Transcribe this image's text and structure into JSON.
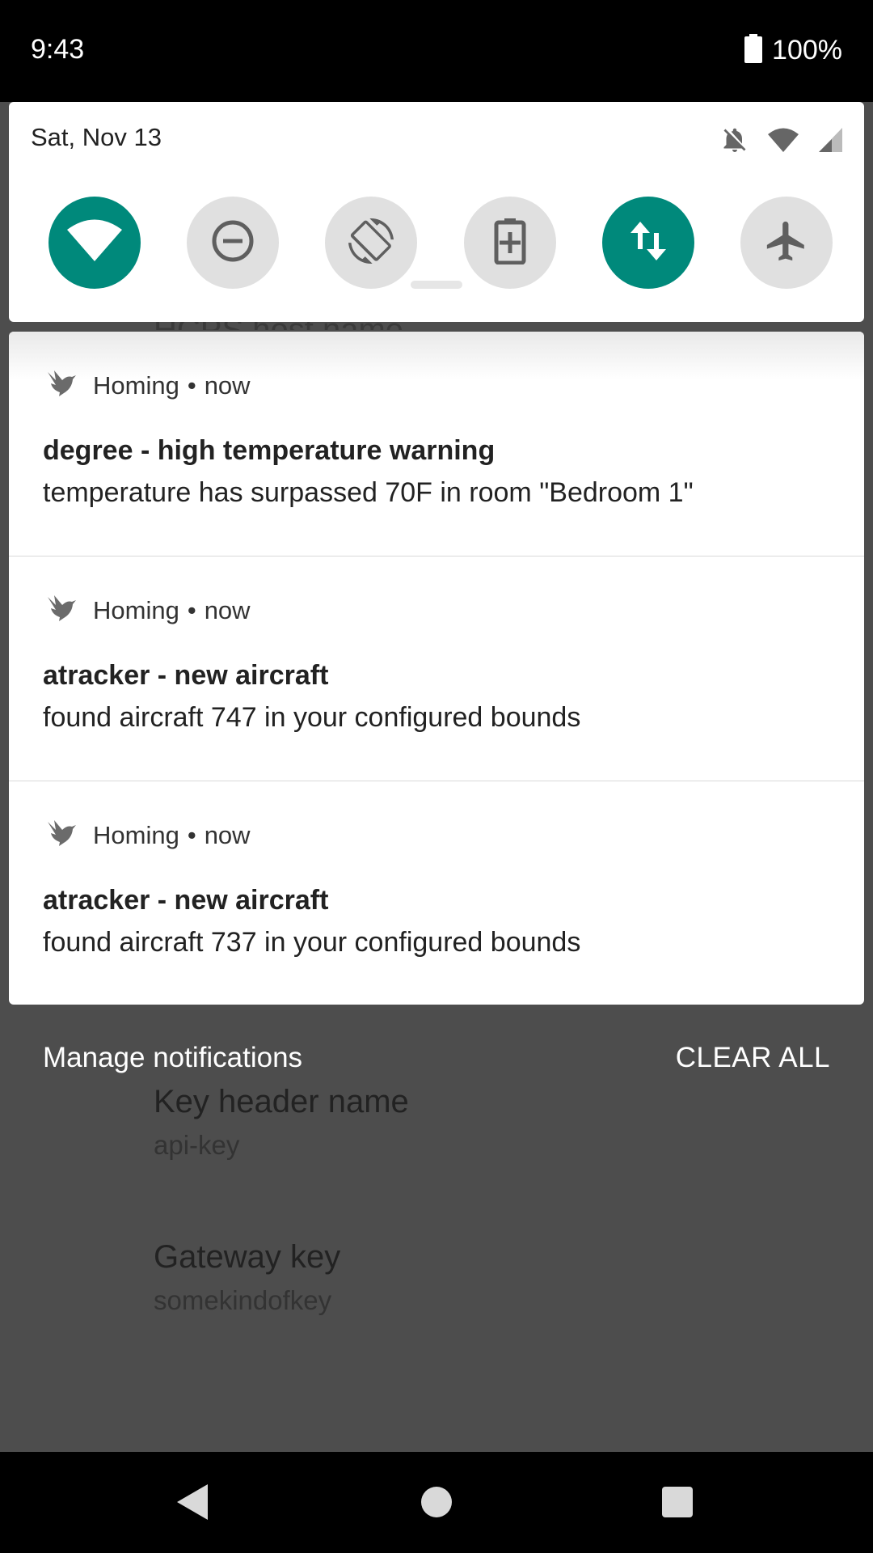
{
  "status_bar": {
    "time": "9:43",
    "battery_percent": "100%"
  },
  "background_app": {
    "peek_text": "HCPS host name",
    "items": [
      {
        "title": "Key header name",
        "value": "api-key"
      },
      {
        "title": "Gateway key",
        "value": "somekindofkey"
      }
    ]
  },
  "quick_settings": {
    "date": "Sat, Nov 13",
    "indicators": [
      "bell-off-icon",
      "wifi-icon",
      "cell-signal-icon"
    ],
    "tiles": [
      {
        "name": "wifi",
        "icon": "wifi-icon",
        "active": true
      },
      {
        "name": "do-not-disturb",
        "icon": "do-not-disturb-icon",
        "active": false
      },
      {
        "name": "auto-rotate",
        "icon": "rotate-icon",
        "active": false
      },
      {
        "name": "battery-saver",
        "icon": "battery-saver-icon",
        "active": false
      },
      {
        "name": "mobile-data",
        "icon": "data-arrows-icon",
        "active": true
      },
      {
        "name": "airplane-mode",
        "icon": "airplane-icon",
        "active": false
      }
    ],
    "accent_color": "#00897b"
  },
  "notifications": [
    {
      "app": "Homing",
      "separator": "•",
      "time": "now",
      "title": "degree - high temperature warning",
      "text": "temperature has surpassed 70F in room \"Bedroom 1\""
    },
    {
      "app": "Homing",
      "separator": "•",
      "time": "now",
      "title": "atracker - new aircraft",
      "text": "found aircraft 747 in your configured bounds"
    },
    {
      "app": "Homing",
      "separator": "•",
      "time": "now",
      "title": "atracker - new aircraft",
      "text": "found aircraft 737 in your configured bounds"
    }
  ],
  "footer": {
    "manage_label": "Manage notifications",
    "clear_label": "CLEAR ALL"
  },
  "nav_bar": {
    "buttons": [
      "back-icon",
      "home-icon",
      "recents-icon"
    ]
  }
}
